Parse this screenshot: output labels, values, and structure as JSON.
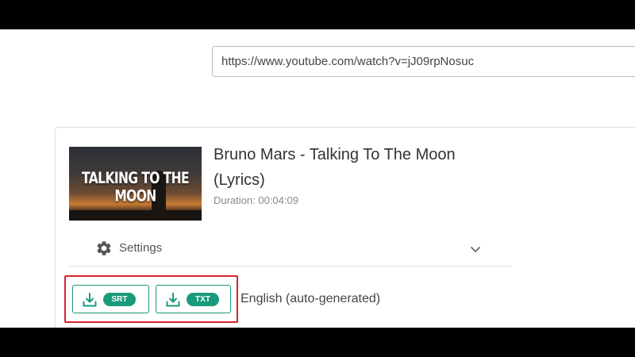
{
  "url_input": {
    "value": "https://www.youtube.com/watch?v=jJ09rpNosuc"
  },
  "video": {
    "thumbnail_text": "TALKING TO THE MOON",
    "title": "Bruno Mars - Talking To The Moon (Lyrics)",
    "duration": "Duration: 00:04:09"
  },
  "settings": {
    "label": "Settings",
    "icon": "gear-icon",
    "toggle_icon": "chevron-down-icon"
  },
  "downloads": {
    "buttons": [
      {
        "format": "SRT",
        "icon": "download-icon"
      },
      {
        "format": "TXT",
        "icon": "download-icon"
      }
    ],
    "language": "English (auto-generated)"
  },
  "colors": {
    "accent": "#1a9a7c",
    "highlight": "#d9232d",
    "letterbox": "#000000"
  }
}
